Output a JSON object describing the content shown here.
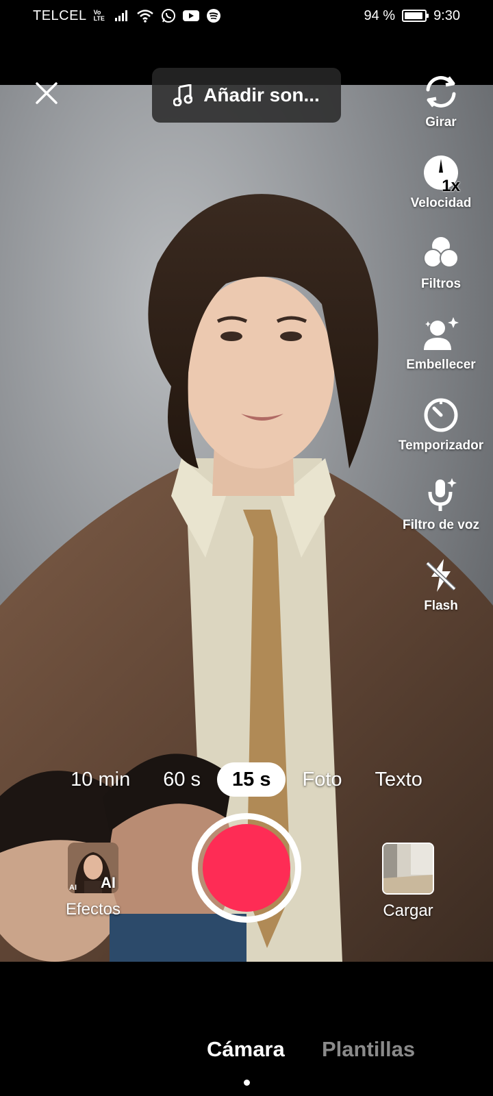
{
  "status_bar": {
    "carrier": "TELCEL",
    "volte_top": "Vo",
    "volte_bottom": "LTE",
    "battery_text": "94 %",
    "battery_level": 0.94,
    "time": "9:30",
    "icons": [
      "signal-icon",
      "wifi-icon",
      "whatsapp-icon",
      "youtube-icon",
      "spotify-icon",
      "battery-icon"
    ]
  },
  "top": {
    "close_icon": "close-icon",
    "sound_label": "Añadir son..."
  },
  "tools": [
    {
      "name": "flip",
      "label": "Girar",
      "icon": "flip-camera-icon"
    },
    {
      "name": "speed",
      "label": "Velocidad",
      "icon": "speed-icon",
      "badge": "1x"
    },
    {
      "name": "filters",
      "label": "Filtros",
      "icon": "filters-icon"
    },
    {
      "name": "beautify",
      "label": "Embellecer",
      "icon": "beautify-icon"
    },
    {
      "name": "timer",
      "label": "Temporizador",
      "icon": "timer-icon"
    },
    {
      "name": "voice-filter",
      "label": "Filtro de voz",
      "icon": "voice-filter-icon"
    },
    {
      "name": "flash",
      "label": "Flash",
      "icon": "flash-off-icon"
    }
  ],
  "modes": [
    "10 min",
    "60 s",
    "15 s",
    "Foto",
    "Texto"
  ],
  "active_mode": "15 s",
  "bottom": {
    "effects_label": "Efectos",
    "effects_badge": "AI",
    "effects_badge_small": "AI",
    "upload_label": "Cargar",
    "record_color": "#fe2c55"
  },
  "nav": {
    "camera": "Cámara",
    "templates": "Plantillas",
    "active": "Cámara"
  }
}
